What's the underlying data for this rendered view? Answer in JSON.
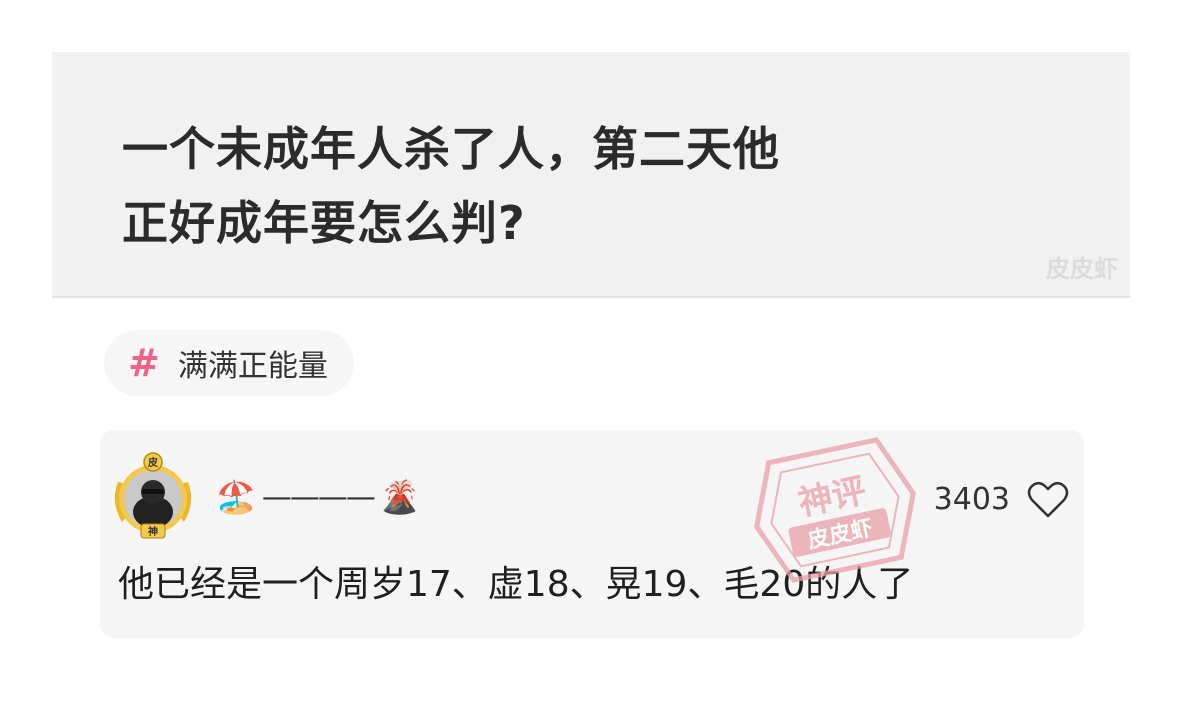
{
  "post": {
    "title_line1": "一个未成年人杀了人，第二天他",
    "title_line2": "正好成年要怎么判?",
    "watermark": "皮皮虾"
  },
  "tag": {
    "icon": "hash-icon",
    "symbol": "#",
    "label": "满满正能量",
    "color": "#f0648a"
  },
  "comment": {
    "username_emoji_left": "🏖️",
    "username_dashes": "————",
    "username_emoji_right": "🌋",
    "like_count": "3403",
    "text": "他已经是一个周岁17、虚18、晃19、毛20的人了",
    "avatar_badge_top": "皮",
    "avatar_badge_bottom": "神"
  },
  "stamp": {
    "line1": "神评",
    "line2": "皮皮虾",
    "color": "#e8a0a8"
  }
}
